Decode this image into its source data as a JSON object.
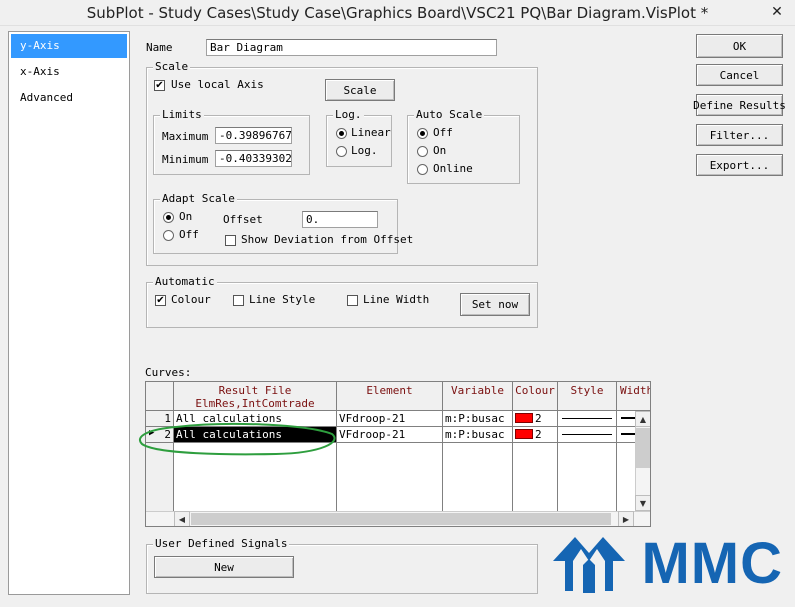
{
  "window": {
    "title": "SubPlot - Study Cases\\Study Case\\Graphics Board\\VSC21 PQ\\Bar Diagram.VisPlot *",
    "close_label": "✕"
  },
  "nav": {
    "items": [
      {
        "label": "y-Axis",
        "selected": true
      },
      {
        "label": "x-Axis"
      },
      {
        "label": "Advanced"
      }
    ]
  },
  "name_field": {
    "label": "Name",
    "value": "Bar Diagram"
  },
  "scale": {
    "title": "Scale",
    "use_local_axis": {
      "label": "Use local Axis",
      "checked": true
    },
    "scale_button": "Scale",
    "limits": {
      "title": "Limits",
      "maximum_label": "Maximum",
      "maximum_value": "-0.398967672",
      "minimum_label": "Minimum",
      "minimum_value": "-0.403393021"
    },
    "log": {
      "title": "Log.",
      "options": [
        {
          "label": "Linear",
          "selected": true
        },
        {
          "label": "Log.",
          "selected": false
        }
      ]
    },
    "auto_scale": {
      "title": "Auto Scale",
      "options": [
        {
          "label": "Off",
          "selected": true
        },
        {
          "label": "On",
          "selected": false
        },
        {
          "label": "Online",
          "selected": false
        }
      ]
    },
    "adapt_scale": {
      "title": "Adapt Scale",
      "on_label": "On",
      "off_label": "Off",
      "offset_label": "Offset",
      "offset_value": "0.",
      "show_deviation_label": "Show Deviation from Offset",
      "show_deviation_checked": false
    }
  },
  "automatic": {
    "title": "Automatic",
    "colour_label": "Colour",
    "colour_checked": true,
    "line_style_label": "Line Style",
    "line_width_label": "Line Width",
    "set_now_button": "Set now"
  },
  "curves": {
    "label": "Curves:",
    "headers": {
      "result_file_line1": "Result File",
      "result_file_line2": "ElmRes,IntComtrade",
      "element": "Element",
      "variable": "Variable",
      "colour": "Colour",
      "style": "Style",
      "width": "Width"
    },
    "rows": [
      {
        "num": "1",
        "result_file": "All calculations",
        "element": "VFdroop-21",
        "variable": "m:P:busac",
        "colour_value": "2",
        "colour_hex": "#ff0000",
        "current": false
      },
      {
        "num": "2",
        "result_file": "All calculations",
        "element": "VFdroop-21",
        "variable": "m:P:busac",
        "colour_value": "2",
        "colour_hex": "#ff0000",
        "current": true
      }
    ]
  },
  "user_defined_signals": {
    "title": "User Defined Signals",
    "new_button": "New"
  },
  "buttons": {
    "ok": "OK",
    "cancel": "Cancel",
    "define_results": "Define Results",
    "filter": "Filter...",
    "export": "Export..."
  },
  "logo": {
    "text": "MMC"
  },
  "colors": {
    "selection": "#3399ff",
    "header_text": "#7a1010",
    "annotation": "#2e9e3e",
    "logo": "#1565b3"
  }
}
